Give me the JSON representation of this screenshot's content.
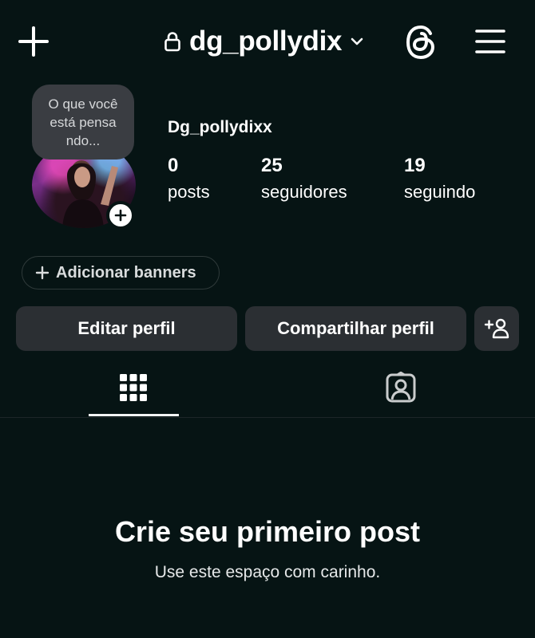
{
  "header": {
    "username": "dg_pollydix",
    "icons": [
      "plus-icon",
      "lock-icon",
      "chevron-down-icon",
      "threads-icon",
      "hamburger-menu-icon"
    ]
  },
  "profile": {
    "note": "O que você está pensa ndo...",
    "display_name": "Dg_pollydixx",
    "stats": [
      {
        "value": "0",
        "label": "posts"
      },
      {
        "value": "25",
        "label": "seguidores"
      },
      {
        "value": "19",
        "label": "seguindo"
      }
    ]
  },
  "banners": {
    "label": "Adicionar banners"
  },
  "actions": {
    "edit_label": "Editar perfil",
    "share_label": "Compartilhar perfil"
  },
  "tabs": [
    {
      "icon": "grid-icon",
      "selected": true
    },
    {
      "icon": "tagged-person-icon",
      "selected": false
    }
  ],
  "empty_state": {
    "title": "Crie seu primeiro post",
    "subtitle": "Use este espaço com carinho."
  },
  "colors": {
    "background": "#061414",
    "button": "#2b2f33",
    "text": "#ffffff"
  }
}
